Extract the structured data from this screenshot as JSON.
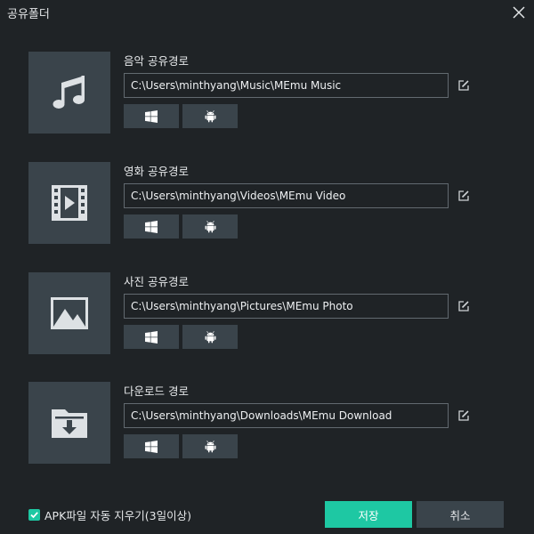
{
  "window": {
    "title": "공유폴더"
  },
  "sections": [
    {
      "id": "music",
      "label": "음악 공유경로",
      "path": "C:\\Users\\minthyang\\Music\\MEmu Music",
      "icon": "music-note-icon"
    },
    {
      "id": "video",
      "label": "영화 공유경로",
      "path": "C:\\Users\\minthyang\\Videos\\MEmu Video",
      "icon": "film-play-icon"
    },
    {
      "id": "photo",
      "label": "사진 공유경로",
      "path": "C:\\Users\\minthyang\\Pictures\\MEmu Photo",
      "icon": "landscape-image-icon"
    },
    {
      "id": "download",
      "label": "다운로드 경로",
      "path": "C:\\Users\\minthyang\\Downloads\\MEmu Download",
      "icon": "folder-download-icon"
    }
  ],
  "options": {
    "auto_delete_apk_label": "APK파일 자동 지우기(3일이상)",
    "auto_delete_apk_checked": true
  },
  "buttons": {
    "save": "저장",
    "cancel": "취소"
  },
  "colors": {
    "background": "#1f2326",
    "panel": "#3a444b",
    "accent": "#1ec8a3",
    "icon": "#dde1e4"
  }
}
